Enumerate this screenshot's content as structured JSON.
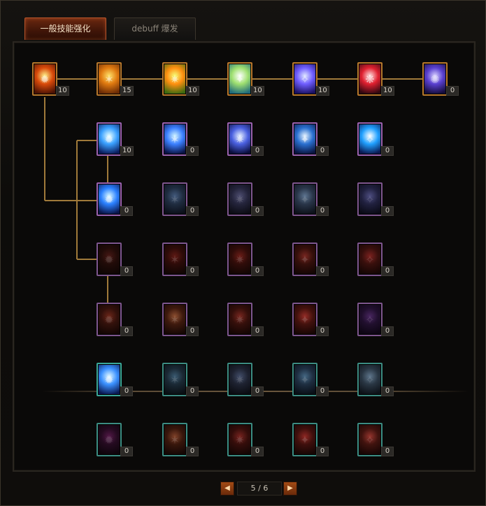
{
  "tabs": [
    {
      "label": "一般技能强化",
      "active": true
    },
    {
      "label": "debuff 爆发",
      "active": false
    }
  ],
  "tree": {
    "row1": [
      {
        "icon": "flame-burst-icon",
        "count": "10",
        "colors": [
          "#fff28a",
          "#d94a0a",
          "#4a1204"
        ],
        "state": "lit"
      },
      {
        "icon": "flame-slash-icon",
        "count": "15",
        "colors": [
          "#ffe26a",
          "#e07a10",
          "#6a2a05"
        ],
        "state": "lit"
      },
      {
        "icon": "green-sparkle-icon",
        "count": "10",
        "colors": [
          "#f6ff7a",
          "#ff8f10",
          "#3c6a10"
        ],
        "state": "lit"
      },
      {
        "icon": "light-pillar-icon",
        "count": "10",
        "colors": [
          "#ffffff",
          "#9fe070",
          "#206a7a"
        ],
        "state": "lit"
      },
      {
        "icon": "arcane-orb-icon",
        "count": "10",
        "colors": [
          "#dfe7ff",
          "#6f5dff",
          "#1a1060"
        ],
        "state": "lit"
      },
      {
        "icon": "red-blade-icon",
        "count": "10",
        "colors": [
          "#ffdede",
          "#e02030",
          "#300810"
        ],
        "state": "lit"
      },
      {
        "icon": "violet-staff-icon",
        "count": "0",
        "colors": [
          "#d8d0ff",
          "#5a40d0",
          "#140c3a"
        ],
        "state": "lit"
      }
    ],
    "row2": [
      {
        "icon": "ice-slash-icon",
        "count": "10",
        "colors": [
          "#e8ffff",
          "#3aa0ff",
          "#0a1a5a"
        ],
        "state": "lit"
      },
      {
        "icon": "ice-crystal-icon",
        "count": "0",
        "colors": [
          "#d0f4ff",
          "#3b80ff",
          "#0a1244"
        ],
        "state": "lit"
      },
      {
        "icon": "ice-spirits-icon",
        "count": "0",
        "colors": [
          "#e6f0ff",
          "#4a60e0",
          "#0a0d3a"
        ],
        "state": "lit"
      },
      {
        "icon": "ice-totem-icon",
        "count": "0",
        "colors": [
          "#e8f4ff",
          "#2a70d0",
          "#0a1440"
        ],
        "state": "lit"
      },
      {
        "icon": "ice-power-icon",
        "count": "0",
        "colors": [
          "#ffffff",
          "#20a0ff",
          "#0a1850"
        ],
        "state": "lit"
      }
    ],
    "row3": [
      {
        "icon": "frost-beam-icon",
        "count": "0",
        "colors": [
          "#d8f8ff",
          "#2a80ff",
          "#0a1448"
        ],
        "state": "lit"
      },
      {
        "icon": "frost-warrior-icon",
        "count": "0",
        "colors": [
          "#4a6a9a",
          "#22344f",
          "#0c1220"
        ],
        "state": "dim"
      },
      {
        "icon": "frost-spirits-icon",
        "count": "0",
        "colors": [
          "#5a5a8a",
          "#2a2a4a",
          "#0e0e1a"
        ],
        "state": "dim"
      },
      {
        "icon": "frost-totem-icon",
        "count": "0",
        "colors": [
          "#6a8ab0",
          "#2e3f5a",
          "#0e1420"
        ],
        "state": "dim"
      },
      {
        "icon": "frost-rune-icon",
        "count": "0",
        "colors": [
          "#5a5aa0",
          "#262650",
          "#0c0c1c"
        ],
        "state": "dim"
      }
    ],
    "row4": [
      {
        "icon": "ember-sigil-icon",
        "count": "0",
        "colors": [
          "#5a1a14",
          "#2a0c08",
          "#120604"
        ],
        "state": "dim"
      },
      {
        "icon": "ember-warrior-icon",
        "count": "0",
        "colors": [
          "#7a1a14",
          "#3a0c08",
          "#160604"
        ],
        "state": "dim"
      },
      {
        "icon": "ember-spirits-icon",
        "count": "0",
        "colors": [
          "#8a1e18",
          "#3e0d08",
          "#180604"
        ],
        "state": "dim"
      },
      {
        "icon": "ember-totem-icon",
        "count": "0",
        "colors": [
          "#9a2a22",
          "#44100a",
          "#1a0604"
        ],
        "state": "dim"
      },
      {
        "icon": "ember-power-icon",
        "count": "0",
        "colors": [
          "#a02420",
          "#48100c",
          "#1a0604"
        ],
        "state": "dim"
      }
    ],
    "row5": [
      {
        "icon": "lava-pillar-icon",
        "count": "0",
        "colors": [
          "#8a2a18",
          "#40120a",
          "#180604"
        ],
        "state": "dim"
      },
      {
        "icon": "lava-arch-icon",
        "count": "0",
        "colors": [
          "#b05a30",
          "#4e1c0c",
          "#1c0804"
        ],
        "state": "dim"
      },
      {
        "icon": "lava-spirits-icon",
        "count": "0",
        "colors": [
          "#9a2a20",
          "#44100a",
          "#1a0604"
        ],
        "state": "dim"
      },
      {
        "icon": "lava-cross-icon",
        "count": "0",
        "colors": [
          "#c03028",
          "#56120c",
          "#1e0604"
        ],
        "state": "dim"
      },
      {
        "icon": "shadow-rune-icon",
        "count": "0",
        "colors": [
          "#5a2a7a",
          "#28103a",
          "#100618"
        ],
        "state": "dim"
      }
    ],
    "row6": [
      {
        "icon": "ice-slash-teal-icon",
        "count": "0",
        "colors": [
          "#e0f8ff",
          "#3a90ff",
          "#0a1850"
        ],
        "state": "lit"
      },
      {
        "icon": "frost-warrior-teal-icon",
        "count": "0",
        "colors": [
          "#3e6a8a",
          "#1c3040",
          "#0a1218"
        ],
        "state": "dim"
      },
      {
        "icon": "frost-spirits-teal-icon",
        "count": "0",
        "colors": [
          "#4a5a80",
          "#22283c",
          "#0c0e16"
        ],
        "state": "dim"
      },
      {
        "icon": "frost-totem-teal-icon",
        "count": "0",
        "colors": [
          "#4a7aa0",
          "#203650",
          "#0a121c"
        ],
        "state": "dim"
      },
      {
        "icon": "frost-rune-teal-icon",
        "count": "0",
        "colors": [
          "#6a8aa8",
          "#2e4052",
          "#0e141c"
        ],
        "state": "dim"
      }
    ],
    "row7": [
      {
        "icon": "shadow-wisp-icon",
        "count": "0",
        "colors": [
          "#6a1a5a",
          "#2e0a28",
          "#12040e"
        ],
        "state": "dim"
      },
      {
        "icon": "lava-arch-teal-icon",
        "count": "0",
        "colors": [
          "#a04a28",
          "#46180a",
          "#1a0804"
        ],
        "state": "dim"
      },
      {
        "icon": "lava-spirits-teal-icon",
        "count": "0",
        "colors": [
          "#9a2620",
          "#440e0a",
          "#1a0604"
        ],
        "state": "dim"
      },
      {
        "icon": "lava-cross-teal-icon",
        "count": "0",
        "colors": [
          "#b82a24",
          "#50100c",
          "#1c0604"
        ],
        "state": "dim"
      },
      {
        "icon": "lava-cross-2-teal-icon",
        "count": "0",
        "colors": [
          "#c03a30",
          "#52140e",
          "#1e0604"
        ],
        "state": "dim"
      }
    ]
  },
  "borders": {
    "row1": "#b8782c",
    "rows2to5": "#9a62b0",
    "rows6to7": "#3aa89a"
  },
  "connector_color": "#a07a3a",
  "pager": {
    "prev_label": "◀",
    "page": "5 / 6",
    "next_label": "▶"
  }
}
